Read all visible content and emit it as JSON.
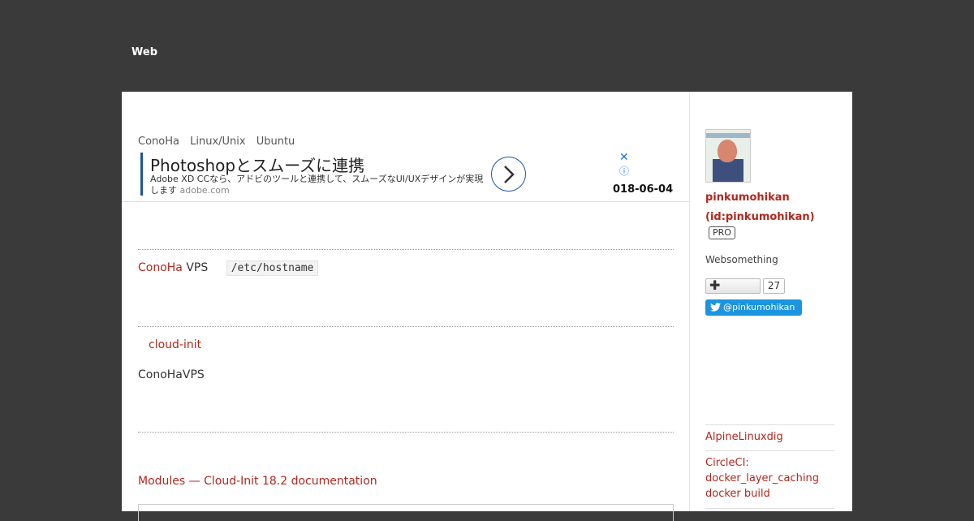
{
  "header": {
    "blog_title": "Web"
  },
  "entry": {
    "categories": [
      "ConoHa",
      "Linux/Unix",
      "Ubuntu"
    ],
    "date": "018-06-04",
    "para1_link": "ConoHa",
    "para1_text": " VPS",
    "para1_code": "/etc/hostname",
    "section_link": "cloud-init",
    "para2_text": "ConoHaVPS",
    "doc_link": "Modules — Cloud-Init 18.2 documentation"
  },
  "ad": {
    "title": "Photoshopとスムーズに連携",
    "description": "Adobe XD CCなら、アドビのツールと連携して、スムーズなUI/UXデザインが実現します",
    "url": "adobe.com",
    "close_glyph": "✕",
    "info_glyph": "ⓘ",
    "arrow_icon": "chevron-right-icon"
  },
  "sidebar": {
    "username": "pinkumohikan (id:pinkumohikan)",
    "pro_badge": "PRO",
    "profile_text": "Websomething",
    "follow_symbol": "✚",
    "follow_count": "27",
    "twitter_handle": "@pinkumohikan",
    "related": [
      "AlpineLinuxdig",
      "CircleCI: docker_layer_caching docker build"
    ]
  },
  "colors": {
    "page_bg": "#3a3a3a",
    "link": "#b3271d",
    "ad_accent": "#1a54a6",
    "twitter": "#1b95e0"
  }
}
